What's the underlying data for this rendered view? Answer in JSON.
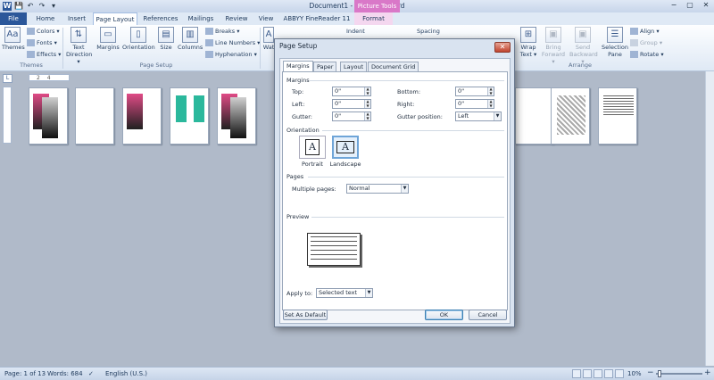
{
  "window": {
    "title": "Document1 - Microsoft Word",
    "context_tab_title": "Picture Tools",
    "minimize": "−",
    "maximize": "▢",
    "close": "✕"
  },
  "qat": {
    "word_icon": "W",
    "save_icon": "💾",
    "undo_icon": "↶",
    "redo_icon": "↷",
    "customize_icon": "▾"
  },
  "tabs": [
    "File",
    "Home",
    "Insert",
    "Page Layout",
    "References",
    "Mailings",
    "Review",
    "View",
    "ABBYY FineReader 11",
    "Format"
  ],
  "active_tab": "Page Layout",
  "ribbon": {
    "themes": {
      "themes": "Themes",
      "colors": "Colors ▾",
      "fonts": "Fonts ▾",
      "effects": "Effects ▾",
      "group": "Themes"
    },
    "page_setup": {
      "text_direction": "Text Direction ▾",
      "margins": "Margins",
      "orientation": "Orientation",
      "size": "Size",
      "columns": "Columns",
      "breaks": "Breaks ▾",
      "line_numbers": "Line Numbers ▾",
      "hyphenation": "Hyphenation ▾",
      "group": "Page Setup"
    },
    "watermark_partial": "Wat",
    "indent": "Indent",
    "spacing": "Spacing",
    "arrange": {
      "wrap_text": "Wrap Text ▾",
      "bring_forward": "Bring Forward ▾",
      "send_backward": "Send Backward ▾",
      "selection_pane": "Selection Pane",
      "align": "Align ▾",
      "group_btn": "Group ▾",
      "rotate": "Rotate ▾",
      "group": "Arrange"
    }
  },
  "ruler": {
    "corner": "L",
    "marks": "2 4"
  },
  "dialog": {
    "title": "Page Setup",
    "close": "✕",
    "tabs": [
      "Margins",
      "Paper",
      "Layout",
      "Document Grid"
    ],
    "active_tab": "Margins",
    "margins_section": "Margins",
    "top_label": "Top:",
    "top_value": "0\"",
    "bottom_label": "Bottom:",
    "bottom_value": "0\"",
    "left_label": "Left:",
    "left_value": "0\"",
    "right_label": "Right:",
    "right_value": "0\"",
    "gutter_label": "Gutter:",
    "gutter_value": "0\"",
    "gutter_position_label": "Gutter position:",
    "gutter_position_value": "Left",
    "orientation_section": "Orientation",
    "portrait": "Portrait",
    "landscape": "Landscape",
    "selected_orientation": "Landscape",
    "pages_section": "Pages",
    "multiple_pages_label": "Multiple pages:",
    "multiple_pages_value": "Normal",
    "preview_section": "Preview",
    "apply_to_label": "Apply to:",
    "apply_to_value": "Selected text",
    "set_as_default": "Set As Default",
    "ok": "OK",
    "cancel": "Cancel"
  },
  "statusbar": {
    "page": "Page: 1 of 13",
    "words": "Words: 684",
    "language": "English (U.S.)",
    "zoom": "10%",
    "zoom_value_percent": 10
  }
}
